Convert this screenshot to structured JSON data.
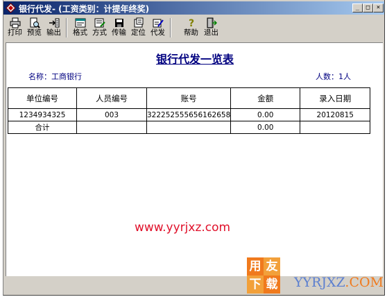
{
  "window": {
    "title": "银行代发- (工资类别：计提年终奖)"
  },
  "title_buttons": {
    "minimize": "_",
    "maximize": "□",
    "close": "×"
  },
  "toolbar": [
    {
      "label": "打印",
      "icon": "printer-icon"
    },
    {
      "label": "预览",
      "icon": "preview-icon"
    },
    {
      "label": "输出",
      "icon": "export-icon"
    },
    {
      "label": "格式",
      "icon": "format-icon"
    },
    {
      "label": "方式",
      "icon": "method-icon"
    },
    {
      "label": "传输",
      "icon": "transfer-disk-icon"
    },
    {
      "label": "定位",
      "icon": "locate-icon"
    },
    {
      "label": "代发",
      "icon": "payroll-edit-icon"
    },
    {
      "label": "帮助",
      "icon": "help-icon"
    },
    {
      "label": "退出",
      "icon": "exit-icon"
    }
  ],
  "report": {
    "title": "银行代发一览表",
    "bank_label": "名称：工商银行",
    "count_label": "人数：1人",
    "columns": [
      "单位编号",
      "人员编号",
      "账号",
      "金额",
      "录入日期"
    ],
    "rows": [
      [
        "1234934325",
        "003",
        "322252555656162658",
        "0.00",
        "20120815"
      ],
      [
        "合计",
        "",
        "",
        "0.00",
        ""
      ]
    ]
  },
  "watermark": {
    "text": "www.yyrjxz.com"
  },
  "logo": {
    "chars": [
      "用",
      "友",
      "下",
      "载"
    ],
    "site_left": "YYRJXZ",
    "site_right": ".COM"
  },
  "colors": {
    "titlebar_start": "#0a246a",
    "titlebar_end": "#a6caf0",
    "report_title": "#000080",
    "watermark": "#e0102a",
    "logo_orange": "#f07a1d",
    "logo_blue": "#5b7fd0"
  }
}
